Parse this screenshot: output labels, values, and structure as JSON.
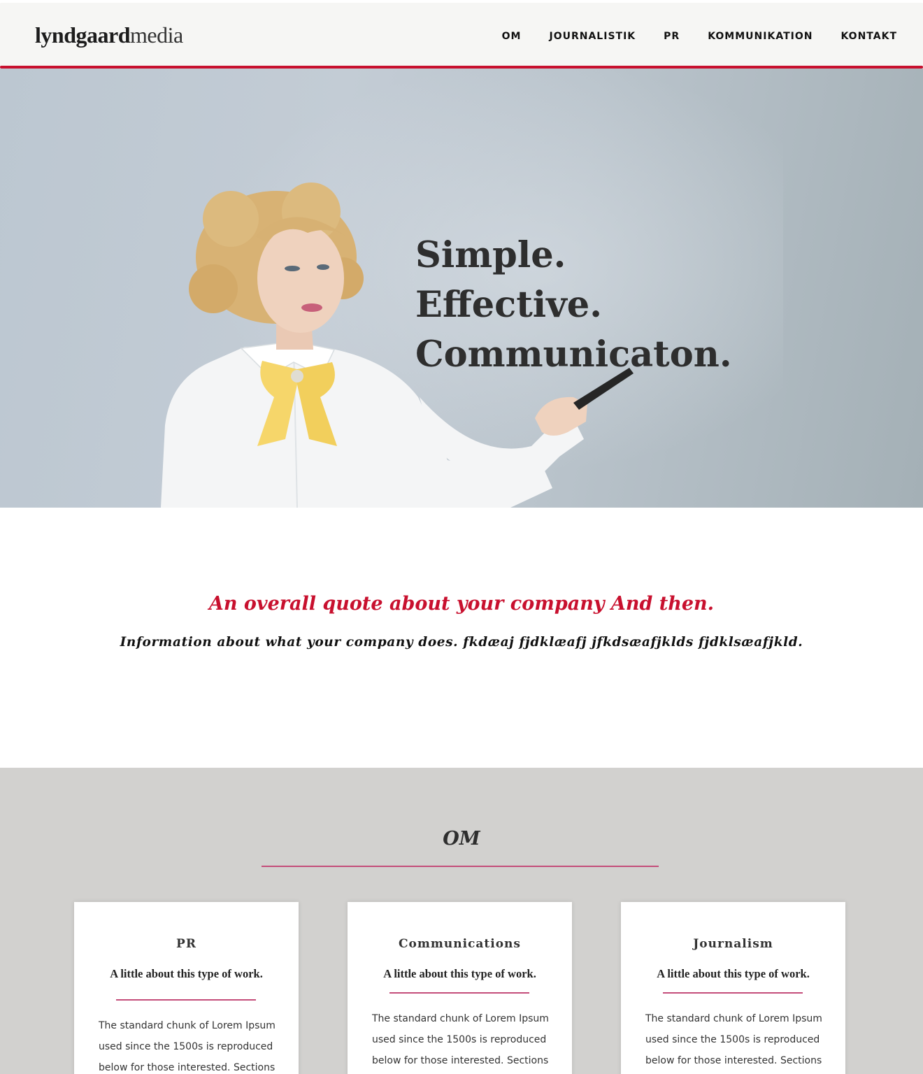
{
  "header": {
    "logo_bold": "lyndgaard",
    "logo_light": "media",
    "nav": [
      "OM",
      "JOURNALISTIK",
      "PR",
      "KOMMUNIKATION",
      "KONTAKT"
    ]
  },
  "hero": {
    "lines": [
      "Simple.",
      "Effective.",
      "Communicaton."
    ]
  },
  "intro": {
    "quote": "An overall quote about your company And then.",
    "info": "Information about what your company does. fkdæaj fjdklæafj jfkdsæafjklds fjdklsæafjkld."
  },
  "om": {
    "title": "OM",
    "cards": [
      {
        "title": "PR",
        "subtitle": "A little about this type of work.",
        "body": "The standard chunk of Lorem Ipsum used since the 1500s is reproduced below for those interested. Sections"
      },
      {
        "title": "Communications",
        "subtitle": "A little about this type of work.",
        "body": "The standard chunk of Lorem Ipsum used since the 1500s is reproduced below for those interested. Sections"
      },
      {
        "title": "Journalism",
        "subtitle": "A little about this type of work.",
        "body": "The standard chunk of Lorem Ipsum used since the 1500s is reproduced below for those interested. Sections"
      }
    ]
  },
  "colors": {
    "accent": "#c8102e",
    "rule": "#c44d7a",
    "section_bg": "#d2d1cf",
    "header_bg": "#f6f6f4"
  }
}
